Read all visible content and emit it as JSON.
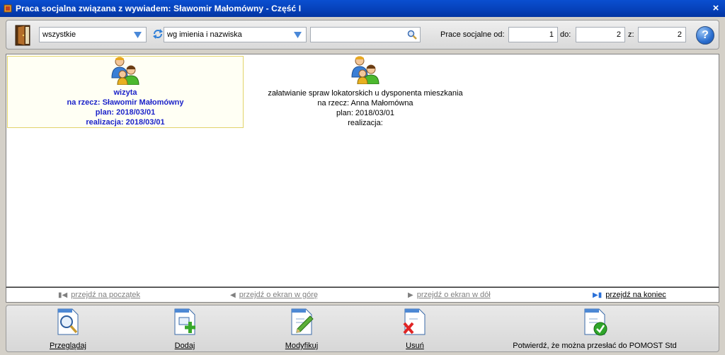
{
  "window": {
    "title": "Praca socjalna związana z wywiadem: Sławomir Małomówny - Część I",
    "close_label": "×"
  },
  "toolbar": {
    "filter_value": "wszystkie",
    "sort_value": "wg imienia i nazwiska",
    "search_value": "",
    "prace_label": "Prace socjalne od:",
    "from_value": "1",
    "to_label": "do:",
    "to_value": "2",
    "of_label": "z:",
    "of_value": "2",
    "help_label": "?"
  },
  "cards": [
    {
      "title": "wizyta",
      "recipient": "na rzecz: Sławomir Małomówny",
      "plan": "plan: 2018/03/01",
      "realization": "realizacja: 2018/03/01",
      "selected": true
    },
    {
      "title": "załatwianie spraw lokatorskich u dysponenta mieszkania",
      "recipient": "na rzecz: Anna Małomówna",
      "plan": "plan: 2018/03/01",
      "realization": "realizacja:",
      "selected": false
    }
  ],
  "navigation": {
    "first": "przejdź na początek",
    "up": "przejdź o ekran w górę",
    "down": "przejdź o ekran w dół",
    "last": "przejdź na koniec"
  },
  "actions": {
    "view": "Przeglądaj",
    "add": "Dodaj",
    "modify": "Modyfikuj",
    "delete": "Usuń",
    "confirm": "Potwierdź, że można przesłać do POMOST Std"
  },
  "colors": {
    "titlebar": "#0640b8",
    "selected_text": "#1c23c9",
    "selected_border": "#e2d36a"
  },
  "icons": [
    "app-icon",
    "door-icon",
    "chevron-down-icon",
    "refresh-icon",
    "search-icon",
    "help-icon",
    "persons-icon",
    "first-page-icon",
    "page-up-icon",
    "page-down-icon",
    "last-page-icon",
    "view-document-icon",
    "add-document-icon",
    "edit-document-icon",
    "delete-document-icon",
    "confirm-document-icon"
  ]
}
